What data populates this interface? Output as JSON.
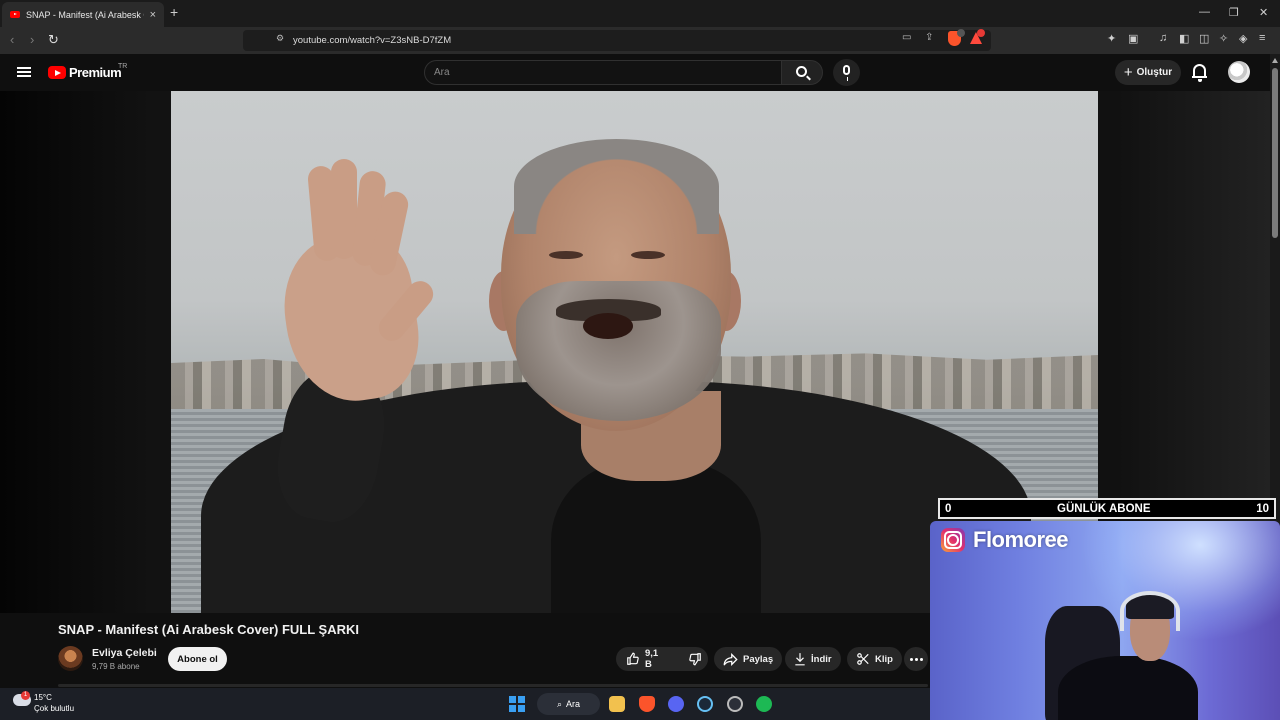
{
  "browser": {
    "tab_title": "SNAP - Manifest (Ai Arabesk Co",
    "tab_close": "×",
    "new_tab": "+",
    "url": "youtube.com/watch?v=Z3sNB-D7fZM",
    "brave_badge": "9",
    "window_controls": [
      "—",
      "❐",
      "✕"
    ]
  },
  "youtube": {
    "logo_text": "Premium",
    "country_code": "TR",
    "search_placeholder": "Ara",
    "create_label": "Oluştur"
  },
  "video": {
    "title": "SNAP - Manifest (Ai Arabesk Cover) FULL ŞARKI",
    "channel_name": "Evliya Çelebi",
    "subscriber_count": "9,79 B abone",
    "subscribe_label": "Abone ol",
    "like_count": "9,1 B",
    "share_label": "Paylaş",
    "download_label": "İndir",
    "clip_label": "Klip"
  },
  "overlay": {
    "goal_min": "0",
    "goal_label": "GÜNLÜK ABONE",
    "goal_max": "10",
    "instagram_handle": "Flomoree"
  },
  "taskbar": {
    "temperature": "15°C",
    "weather_desc": "Çok bulutlu",
    "weather_badge": "1",
    "search_label": "Ara"
  },
  "colors": {
    "youtube_red": "#ff0000",
    "background": "#0f0f0f",
    "pill_bg": "#272727"
  }
}
